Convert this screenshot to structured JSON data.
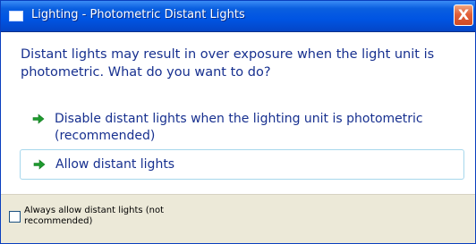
{
  "window": {
    "title": "Lighting - Photometric Distant Lights",
    "close_glyph": "X"
  },
  "main_instruction": "Distant lights may result in over exposure when the light unit is photometric. What do you want to do?",
  "options": [
    {
      "label": "Disable distant lights when the lighting unit is photometric (recommended)",
      "icon": "green-arrow-icon"
    },
    {
      "label": "Allow distant lights",
      "icon": "green-arrow-icon"
    }
  ],
  "footer": {
    "checkbox_label": "Always allow distant lights (not recommended)",
    "checkbox_checked": false
  },
  "colors": {
    "titlebar": "#0054e3",
    "instruction_text": "#17308f",
    "arrow": "#1e9a2e",
    "footer_bg": "#ece9d8",
    "hover_border": "#a7d7ec"
  }
}
